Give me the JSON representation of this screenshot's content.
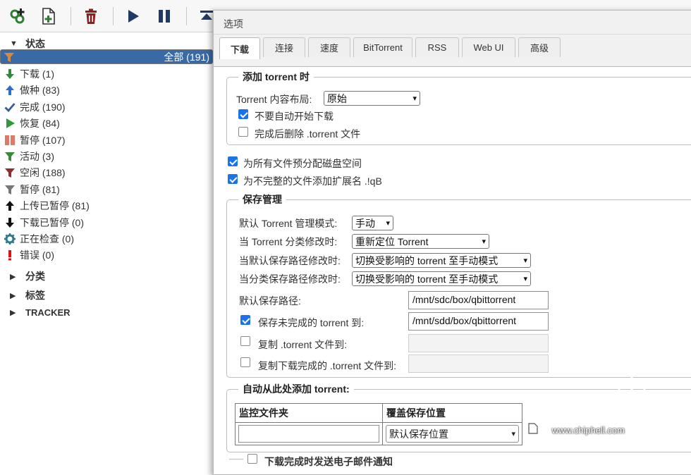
{
  "toolbar": {
    "buttons": [
      {
        "name": "add-torrent-link-button",
        "icon": "link-plus-icon"
      },
      {
        "name": "add-torrent-file-button",
        "icon": "file-plus-icon"
      },
      {
        "name": "delete-button",
        "icon": "trash-icon"
      },
      {
        "name": "resume-button",
        "icon": "play-icon"
      },
      {
        "name": "pause-button",
        "icon": "pause-icon"
      },
      {
        "name": "move-top-button",
        "icon": "move-top-icon"
      }
    ]
  },
  "sidebar": {
    "status_header": "状态",
    "items": [
      {
        "label": "全部 (191)",
        "icon": "funnel-icon",
        "color": "#d9893a",
        "selected": true
      },
      {
        "label": "下载 (1)",
        "icon": "down-arrow-icon",
        "color": "#2e8b3a"
      },
      {
        "label": "做种 (83)",
        "icon": "up-arrow-icon",
        "color": "#2a6fc9"
      },
      {
        "label": "完成 (190)",
        "icon": "checkmark-icon",
        "color": "#3a5f8f"
      },
      {
        "label": "恢复 (84)",
        "icon": "play-icon",
        "color": "#2e9a3a"
      },
      {
        "label": "暂停 (107)",
        "icon": "pause-icon",
        "color": "#e37763"
      },
      {
        "label": "活动 (3)",
        "icon": "funnel-icon",
        "color": "#3a8a3a"
      },
      {
        "label": "空闲 (188)",
        "icon": "funnel-icon",
        "color": "#8a3030"
      },
      {
        "label": "暂停 (81)",
        "icon": "funnel-icon",
        "color": "#777777"
      },
      {
        "label": "上传已暂停 (81)",
        "icon": "up-arrow-icon",
        "color": "#111111"
      },
      {
        "label": "下载已暂停 (0)",
        "icon": "down-arrow-icon",
        "color": "#111111"
      },
      {
        "label": "正在检查 (0)",
        "icon": "gear-icon",
        "color": "#2c7a8a"
      },
      {
        "label": "错误 (0)",
        "icon": "exclamation-icon",
        "color": "#e01010"
      }
    ],
    "sections": [
      "分类",
      "标签",
      "TRACKER"
    ]
  },
  "dialog": {
    "title": "选项",
    "tabs": [
      "下载",
      "连接",
      "速度",
      "BitTorrent",
      "RSS",
      "Web UI",
      "高级"
    ],
    "add_torrent": {
      "legend": "添加 torrent 时",
      "layout_label": "Torrent 内容布局:",
      "layout_value": "原始",
      "dont_start_label": "不要自动开始下载",
      "dont_start_checked": true,
      "delete_torrent_label": "完成后删除 .torrent 文件",
      "delete_torrent_checked": false
    },
    "prealloc_label": "为所有文件预分配磁盘空间",
    "prealloc_checked": true,
    "append_ext_label": "为不完整的文件添加扩展名 .!qB",
    "append_ext_checked": true,
    "save_mgmt": {
      "legend": "保存管理",
      "rows": [
        {
          "label": "默认 Torrent 管理模式:",
          "value": "手动"
        },
        {
          "label": "当 Torrent 分类修改时:",
          "value": "重新定位 Torrent"
        },
        {
          "label": "当默认保存路径修改时:",
          "value": "切换受影响的 torrent 至手动模式"
        },
        {
          "label": "当分类保存路径修改时:",
          "value": "切换受影响的 torrent 至手动模式"
        }
      ],
      "default_path_label": "默认保存路径:",
      "default_path_value": "/mnt/sdc/box/qbittorrent",
      "incomplete_label": "保存未完成的 torrent 到:",
      "incomplete_checked": true,
      "incomplete_value": "/mnt/sdd/box/qbittorrent",
      "copy_torrent_label": "复制 .torrent 文件到:",
      "copy_torrent_checked": false,
      "copy_finished_label": "复制下载完成的 .torrent 文件到:",
      "copy_finished_checked": false
    },
    "auto_add": {
      "legend": "自动从此处添加 torrent:",
      "col_watch": "监控文件夹",
      "col_override": "覆盖保存位置",
      "watch_value": "",
      "override_value": "默认保存位置"
    },
    "email_label": "下载完成时发送电子邮件通知"
  },
  "watermark": {
    "brand": "chip hell",
    "url": "www.chiphell.com"
  }
}
